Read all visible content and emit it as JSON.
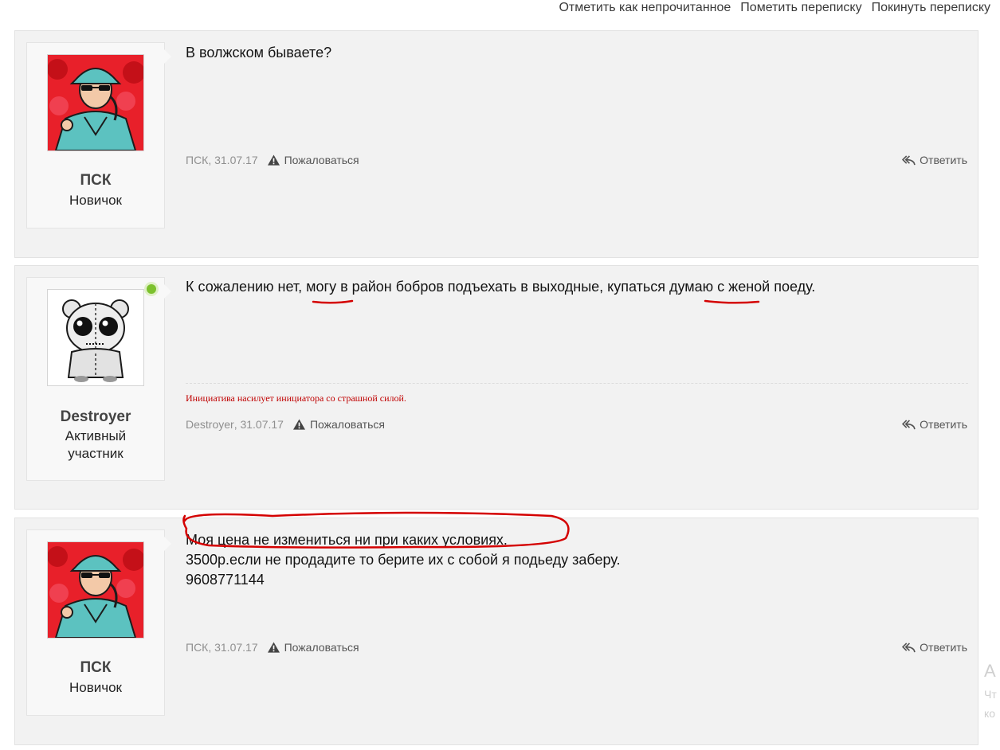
{
  "toolbar": {
    "mark_unread": "Отметить как непрочитанное",
    "star": "Пометить переписку",
    "leave": "Покинуть переписку"
  },
  "messages": [
    {
      "username": "ПСК",
      "user_title": "Новичок",
      "lines": [
        "В волжском бываете?"
      ],
      "author": "ПСК",
      "date": "31.07.17",
      "report": "Пожаловаться",
      "reply": "Ответить"
    },
    {
      "username": "Destroyer",
      "user_title": "Активный участник",
      "lines": [
        "К сожалению нет, могу в район бобров подъехать в выходные, купаться думаю с женой поеду."
      ],
      "signature": "Инициатива насилует инициатора со страшной силой.",
      "author": "Destroyer",
      "date": "31.07.17",
      "report": "Пожаловаться",
      "reply": "Ответить"
    },
    {
      "username": "ПСК",
      "user_title": "Новичок",
      "lines": [
        "Моя цена не измениться ни при каких условиях.",
        "3500р.если не продадите то берите их с собой я подьеду заберу.",
        "9608771144"
      ],
      "author": "ПСК",
      "date": "31.07.17",
      "report": "Пожаловаться",
      "reply": "Ответить"
    }
  ],
  "colors": {
    "annotation": "#d40000",
    "signature": "#c00000",
    "online": "#7cc12d"
  }
}
